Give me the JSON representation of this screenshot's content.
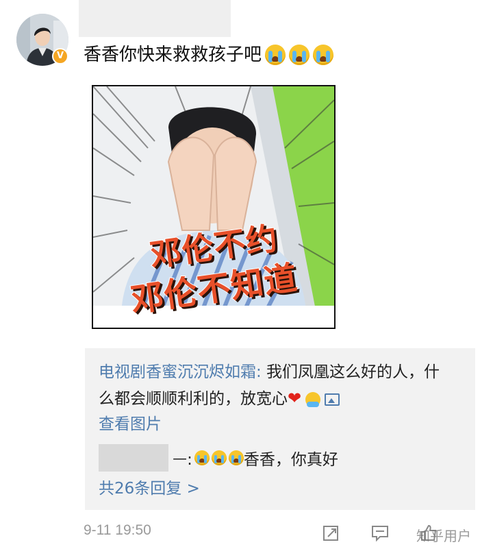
{
  "post": {
    "text": "香香你快来救救孩子吧",
    "emoji_count": 3,
    "verified_badge": "V",
    "meme_caption_line1": "邓伦不约",
    "meme_caption_line2": "邓伦不知道"
  },
  "reply_box": {
    "reply_author": "电视剧香蜜沉沉烬如霜:",
    "reply_text": " 我们凤凰这么好的人，什么都会顺顺利利的，放宽心",
    "heart": "❤",
    "view_picture": "查看图片",
    "sub_reply_suffix": "ᅳ:",
    "sub_reply_text": "香香，你真好",
    "more_replies": "共26条回复 >"
  },
  "footer": {
    "timestamp": "9-11 19:50",
    "watermark": "知乎用户"
  },
  "colors": {
    "link_blue": "#4f7cae",
    "reply_bg": "#f2f2f2",
    "meta_gray": "#9a9a9a"
  },
  "icons": [
    "verified-badge-icon",
    "crying-face-emoji",
    "heart-emoji",
    "hug-emoji",
    "picture-icon",
    "repost-icon",
    "comment-icon",
    "like-icon"
  ]
}
